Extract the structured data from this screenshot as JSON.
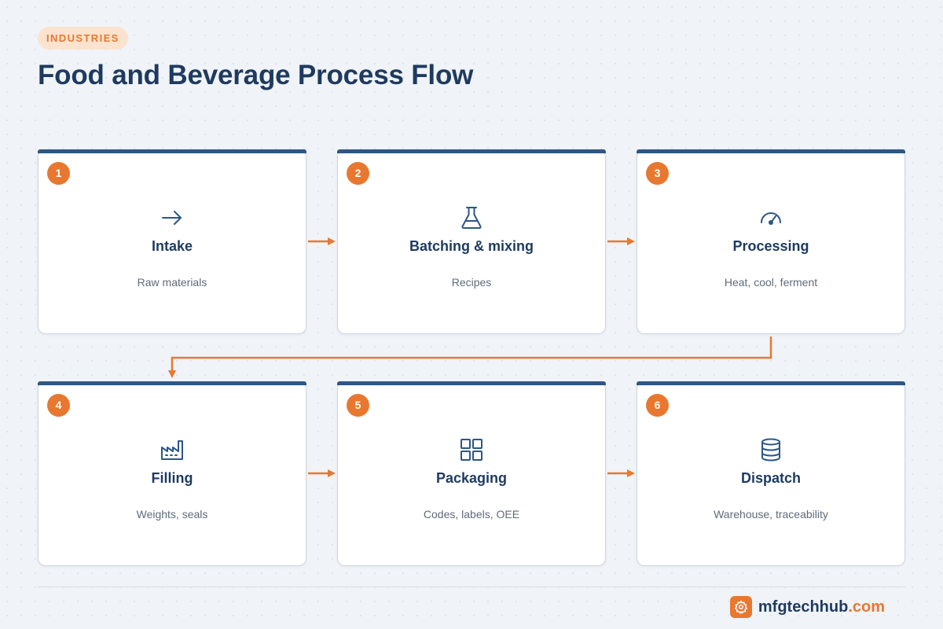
{
  "header": {
    "badge": "INDUSTRIES",
    "title": "Food and Beverage Process Flow"
  },
  "steps": [
    {
      "number": "1",
      "title": "Intake",
      "subtitle": "Raw materials",
      "icon": "arrow-right-icon"
    },
    {
      "number": "2",
      "title": "Batching & mixing",
      "subtitle": "Recipes",
      "icon": "flask-icon"
    },
    {
      "number": "3",
      "title": "Processing",
      "subtitle": "Heat, cool, ferment",
      "icon": "gauge-icon"
    },
    {
      "number": "4",
      "title": "Filling",
      "subtitle": "Weights, seals",
      "icon": "factory-icon"
    },
    {
      "number": "5",
      "title": "Packaging",
      "subtitle": "Codes, labels, OEE",
      "icon": "grid-icon"
    },
    {
      "number": "6",
      "title": "Dispatch",
      "subtitle": "Warehouse, traceability",
      "icon": "database-icon"
    }
  ],
  "footer": {
    "brand_name": "mfgtechhub",
    "brand_tld": ".com",
    "logo_icon": "gear-icon"
  },
  "colors": {
    "accent": "#e8782f",
    "navy": "#1e3a5f",
    "card_bar": "#2d5785",
    "background": "#f0f3f7"
  }
}
